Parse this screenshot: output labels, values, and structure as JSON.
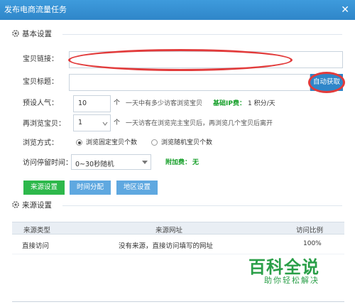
{
  "window": {
    "title": "发布电商流量任务",
    "close_glyph": "✕"
  },
  "basic_section": {
    "title": "基本设置"
  },
  "fields": {
    "item_link_label": "宝贝链接：",
    "item_title_label": "宝贝标题：",
    "auto_fetch_button": "自动获取",
    "popularity_label": "预设人气：",
    "popularity_value": "10",
    "popularity_unit": "个",
    "popularity_hint": "一天中有多少访客浏览宝贝",
    "basic_ip_fee_label": "基础IP费：",
    "basic_ip_fee_value": "1 积分/天",
    "rebrowse_label": "再浏览宝贝：",
    "rebrowse_value": "1",
    "rebrowse_unit": "个",
    "rebrowse_hint": "一天访客在浏览完主宝贝后，再浏览几个宝贝后离开",
    "browse_mode_label": "浏览方式：",
    "browse_mode_fixed": "浏览固定宝贝个数",
    "browse_mode_random": "浏览随机宝贝个数",
    "browse_mode_selected": "fixed",
    "stay_time_label": "访问停留时间：",
    "stay_time_value": "0~30秒随机",
    "extra_fee_label": "附加费：",
    "extra_fee_value": "无"
  },
  "tabs": {
    "source": "来源设置",
    "time": "时间分配",
    "region": "地区设置"
  },
  "source_section": {
    "title": "来源设置"
  },
  "source_table": {
    "headers": [
      "来源类型",
      "来源网址",
      "访问比例"
    ],
    "rows": [
      {
        "type": "直接访问",
        "url": "没有来源，直接访问填写的网址",
        "ratio": "100%"
      }
    ]
  },
  "watermark": {
    "title": "百科全说",
    "subtitle": "助你轻松解决"
  },
  "colors": {
    "titlebar": "#2f86c9",
    "accent_green": "#2db84b",
    "annotation_red": "#e23b3b"
  }
}
